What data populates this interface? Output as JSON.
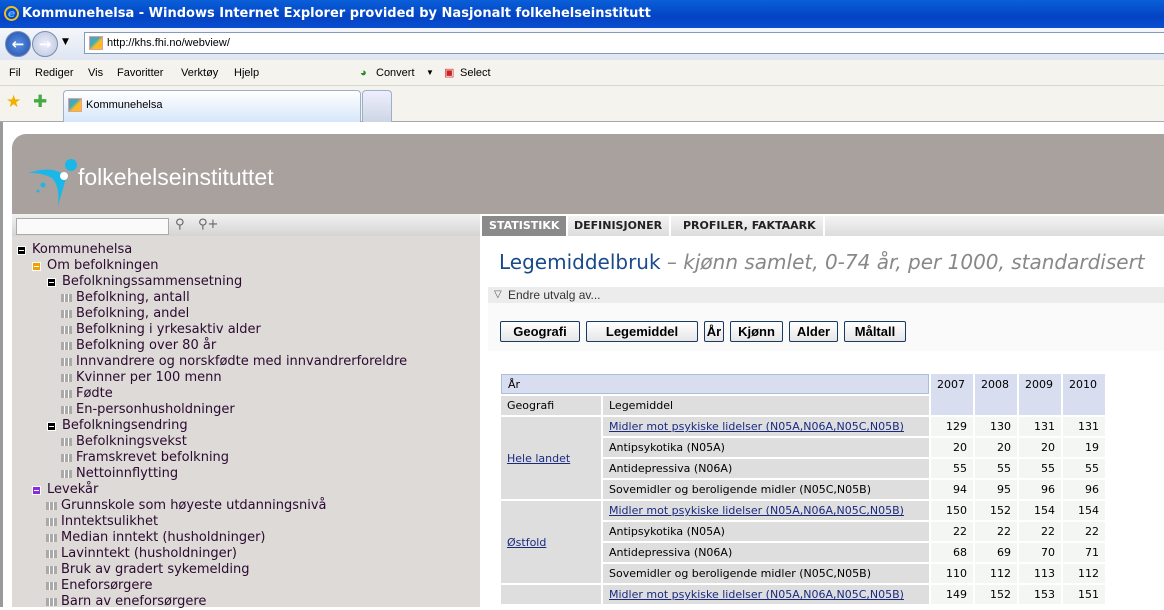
{
  "window": {
    "title": "Kommunehelsa - Windows Internet Explorer provided by Nasjonalt folkehelseinstitutt",
    "url": "http://khs.fhi.no/webview/"
  },
  "menu": [
    "Fil",
    "Rediger",
    "Vis",
    "Favoritter",
    "Verktøy",
    "Hjelp"
  ],
  "toolbar": {
    "convert": "Convert",
    "select": "Select"
  },
  "tab": {
    "label": "Kommunehelsa"
  },
  "site": {
    "logo_text": "folkehelseinstituttet"
  },
  "search": {
    "value": "",
    "placeholder": ""
  },
  "tree": [
    {
      "label": "Kommunehelsa",
      "level": 0,
      "type": "box",
      "color": "#000000"
    },
    {
      "label": "Om befolkningen",
      "level": 1,
      "type": "box",
      "color": "#f0a000"
    },
    {
      "label": "Befolkningssammensetning",
      "level": 2,
      "type": "box",
      "color": "#000000"
    },
    {
      "label": "Befolkning, antall",
      "level": 3,
      "type": "leaf"
    },
    {
      "label": "Befolkning, andel",
      "level": 3,
      "type": "leaf"
    },
    {
      "label": "Befolkning i yrkesaktiv alder",
      "level": 3,
      "type": "leaf"
    },
    {
      "label": "Befolkning over 80 år",
      "level": 3,
      "type": "leaf"
    },
    {
      "label": "Innvandrere og norskfødte med innvandrerforeldre",
      "level": 3,
      "type": "leaf"
    },
    {
      "label": "Kvinner per 100 menn",
      "level": 3,
      "type": "leaf"
    },
    {
      "label": "Fødte",
      "level": 3,
      "type": "leaf"
    },
    {
      "label": "En-personhusholdninger",
      "level": 3,
      "type": "leaf"
    },
    {
      "label": "Befolkningsendring",
      "level": 2,
      "type": "box",
      "color": "#000000"
    },
    {
      "label": "Befolkningsvekst",
      "level": 3,
      "type": "leaf"
    },
    {
      "label": "Framskrevet befolkning",
      "level": 3,
      "type": "leaf"
    },
    {
      "label": "Nettoinnflytting",
      "level": 3,
      "type": "leaf"
    },
    {
      "label": "Levekår",
      "level": 1,
      "type": "box",
      "color": "#8a2be2"
    },
    {
      "label": "Grunnskole som høyeste utdanningsnivå",
      "level": 2,
      "type": "leaf"
    },
    {
      "label": "Inntektsulikhet",
      "level": 2,
      "type": "leaf"
    },
    {
      "label": "Median inntekt (husholdninger)",
      "level": 2,
      "type": "leaf"
    },
    {
      "label": "Lavinntekt (husholdninger)",
      "level": 2,
      "type": "leaf"
    },
    {
      "label": "Bruk av gradert sykemelding",
      "level": 2,
      "type": "leaf"
    },
    {
      "label": "Eneforsørgere",
      "level": 2,
      "type": "leaf"
    },
    {
      "label": "Barn av eneforsørgere",
      "level": 2,
      "type": "leaf"
    }
  ],
  "rtabs": [
    "STATISTIKK",
    "DEFINISJONER",
    "PROFILER, FAKTAARK"
  ],
  "page": {
    "title": "Legemiddelbruk",
    "subtitle": "– kjønn samlet, 0-74 år, per 1000, standardisert",
    "endre": "Endre utvalg av..."
  },
  "buttons": [
    "Geografi",
    "Legemiddel",
    "År",
    "Kjønn",
    "Alder",
    "Måltall"
  ],
  "table": {
    "year_label": "År",
    "geo_label": "Geografi",
    "leg_label": "Legemiddel",
    "years": [
      "2007",
      "2008",
      "2009",
      "2010"
    ],
    "groups": [
      {
        "geo": "Hele landet",
        "rows": [
          {
            "leg": "Midler mot psykiske lidelser (N05A,N06A,N05C,N05B)",
            "link": true,
            "v": [
              "129",
              "130",
              "131",
              "131"
            ]
          },
          {
            "leg": "Antipsykotika (N05A)",
            "v": [
              "20",
              "20",
              "20",
              "19"
            ]
          },
          {
            "leg": "Antidepressiva (N06A)",
            "v": [
              "55",
              "55",
              "55",
              "55"
            ]
          },
          {
            "leg": "Sovemidler og beroligende midler (N05C,N05B)",
            "v": [
              "94",
              "95",
              "96",
              "96"
            ]
          }
        ]
      },
      {
        "geo": "Østfold",
        "rows": [
          {
            "leg": "Midler mot psykiske lidelser (N05A,N06A,N05C,N05B)",
            "link": true,
            "v": [
              "150",
              "152",
              "154",
              "154"
            ]
          },
          {
            "leg": "Antipsykotika (N05A)",
            "v": [
              "22",
              "22",
              "22",
              "22"
            ]
          },
          {
            "leg": "Antidepressiva (N06A)",
            "v": [
              "68",
              "69",
              "70",
              "71"
            ]
          },
          {
            "leg": "Sovemidler og beroligende midler (N05C,N05B)",
            "v": [
              "110",
              "112",
              "113",
              "112"
            ]
          }
        ]
      },
      {
        "geo": "",
        "rows": [
          {
            "leg": "Midler mot psykiske lidelser (N05A,N06A,N05C,N05B)",
            "link": true,
            "v": [
              "149",
              "152",
              "153",
              "151"
            ]
          }
        ]
      }
    ]
  }
}
